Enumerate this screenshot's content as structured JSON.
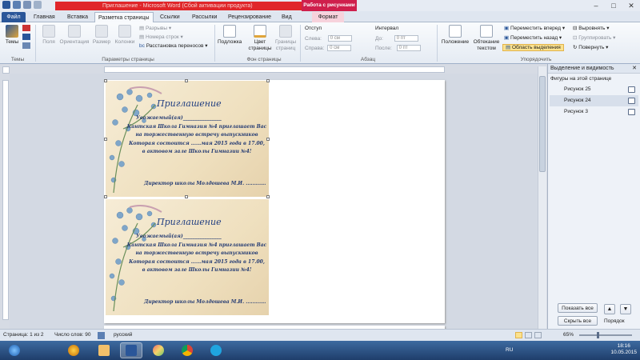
{
  "window": {
    "title": "Приглашение - Microsoft Word (Сбой активации продукта)",
    "context_tab_group": "Работа с рисунками",
    "controls": [
      "–",
      "□",
      "✕"
    ]
  },
  "tabs": [
    {
      "label": "Файл"
    },
    {
      "label": "Главная"
    },
    {
      "label": "Вставка"
    },
    {
      "label": "Разметка страницы"
    },
    {
      "label": "Ссылки"
    },
    {
      "label": "Рассылки"
    },
    {
      "label": "Рецензирование"
    },
    {
      "label": "Вид"
    },
    {
      "label": "Формат"
    }
  ],
  "ribbon": {
    "themes": {
      "themes_label": "Темы",
      "group": "Темы"
    },
    "page_setup": {
      "margins": "Поля",
      "orientation": "Ориентация",
      "size": "Размер",
      "columns": "Колонки",
      "breaks": "Разрывы",
      "line_numbers": "Номера строк",
      "hyphenation": "Расстановка переносов",
      "group": "Параметры страницы"
    },
    "background": {
      "watermark": "Подложка",
      "page_color_line1": "Цвет",
      "page_color_line2": "страницы",
      "page_borders_line1": "Границы",
      "page_borders_line2": "страниц",
      "group": "Фон страницы"
    },
    "paragraph": {
      "indent_title": "Отступ",
      "left_label": "Слева:",
      "left_value": "0 см",
      "right_label": "Справа:",
      "right_value": "0 см",
      "spacing_title": "Интервал",
      "before_label": "До:",
      "before_value": "0 пт",
      "after_label": "После:",
      "after_value": "0 пт",
      "group": "Абзац"
    },
    "arrange": {
      "position": "Положение",
      "wrap_line1": "Обтекание",
      "wrap_line2": "текстом",
      "bring_forward": "Переместить вперед",
      "send_backward": "Переместить назад",
      "selection_pane": "Область выделения",
      "align": "Выровнять",
      "group_btn": "Группировать",
      "rotate": "Повернуть",
      "group": "Упорядочить"
    }
  },
  "invitations": [
    {
      "title": "Приглашение",
      "salutation": "Уважаемый(ая)________________",
      "line1": "Кантская Школа Гимназия №4 приглашает Вас",
      "line2": "на торжественную встречу выпускников",
      "line3": "Которая состоится ......мая 2015 года в 17.00,",
      "line4": "в актовом зале Школы Гимназии №4!",
      "signature": "Директор школы Молдошева М.И. ............"
    },
    {
      "title": "Приглашение",
      "salutation": "Уважаемый(ая)________________",
      "line1": "Кантская Школа Гимназия №4 приглашает Вас",
      "line2": "на торжественную встречу выпускников",
      "line3": "Которая состоится ......мая 2015 года в 17.00,",
      "line4": "в актовом зале Школы Гимназии №4!",
      "signature": "Директор школы Молдошева М.И. ............"
    }
  ],
  "selection_pane": {
    "title": "Выделение и видимость",
    "subtitle": "Фигуры на этой странице",
    "items": [
      {
        "name": "Рисунок 25"
      },
      {
        "name": "Рисунок 24"
      },
      {
        "name": "Рисунок 3"
      }
    ],
    "show_all": "Показать все",
    "hide_all": "Скрыть все",
    "reorder": "Порядок"
  },
  "statusbar": {
    "page": "Страница: 1 из 2",
    "words": "Число слов: 90",
    "language": "русский",
    "zoom": "65%"
  },
  "taskbar": {
    "lang": "RU",
    "time": "18:16",
    "date": "10.05.2015"
  },
  "colors": {
    "title_red": "#e0262a",
    "context_tab": "#cf1f4c",
    "file_tab": "#2a5699",
    "invite_text": "#243b73"
  }
}
